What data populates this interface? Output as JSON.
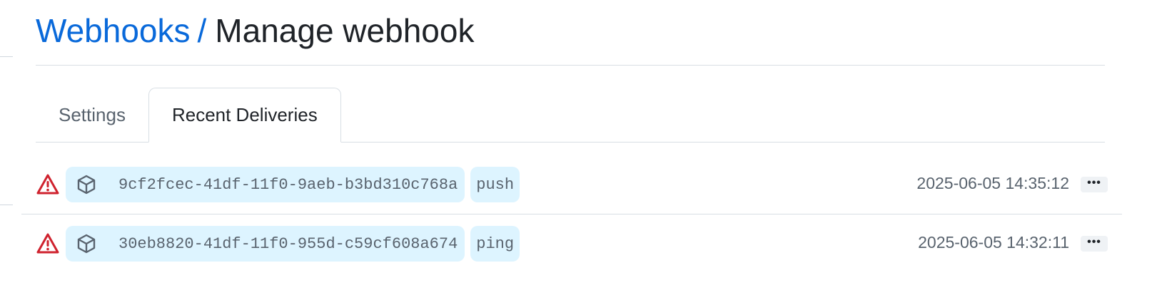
{
  "breadcrumb": {
    "parent": "Webhooks",
    "separator": "/",
    "current": "Manage webhook"
  },
  "tabs": [
    {
      "label": "Settings",
      "selected": false
    },
    {
      "label": "Recent Deliveries",
      "selected": true
    }
  ],
  "deliveries": [
    {
      "status_icon": "alert-icon",
      "status_color": "#cf222e",
      "type_icon": "package-icon",
      "guid": "9cf2fcec-41df-11f0-9aeb-b3bd310c768a",
      "event": "push",
      "timestamp": "2025-06-05 14:35:12",
      "more_label": "•••"
    },
    {
      "status_icon": "alert-icon",
      "status_color": "#cf222e",
      "type_icon": "package-icon",
      "guid": "30eb8820-41df-11f0-955d-c59cf608a674",
      "event": "ping",
      "timestamp": "2025-06-05 14:32:11",
      "more_label": "•••"
    }
  ],
  "colors": {
    "link": "#0969da",
    "pill_bg": "#ddf4ff",
    "danger": "#cf222e",
    "muted": "#59636e"
  }
}
